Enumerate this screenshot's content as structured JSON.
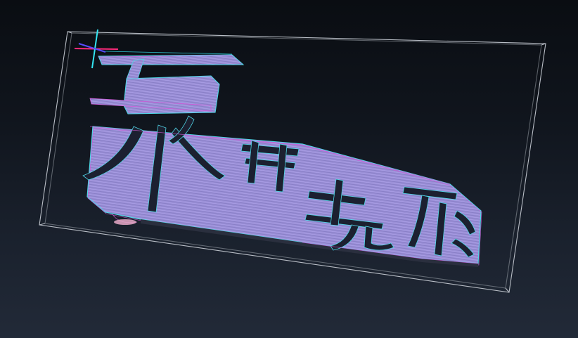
{
  "viewport": {
    "background_top": "#0a0d12",
    "background_bottom": "#222a38",
    "bounding_box_color": "#b9bec6"
  },
  "toolpath": {
    "fill_color": "#9a8fd6",
    "edge_cyan": "#4fd6e6",
    "edge_magenta": "#d15ad8",
    "shadow_color": "#2a2f3e",
    "characters": [
      "飛",
      "鳥",
      "先",
      "飛"
    ]
  },
  "axes": {
    "x_color": "#ff2a7a",
    "y_color": "#33e6f2",
    "z_color": "#5a4bff"
  }
}
